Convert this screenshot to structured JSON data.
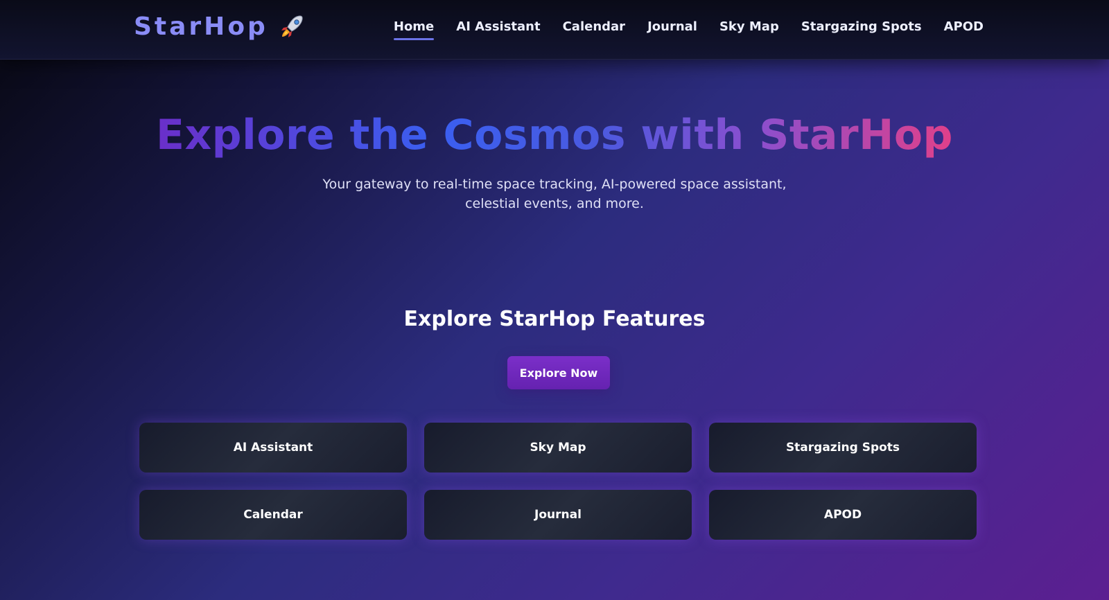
{
  "header": {
    "logo_text": "StarHop",
    "logo_icon": "rocket-icon",
    "nav": [
      {
        "label": "Home",
        "active": true
      },
      {
        "label": "AI Assistant"
      },
      {
        "label": "Calendar"
      },
      {
        "label": "Journal"
      },
      {
        "label": "Sky Map"
      },
      {
        "label": "Stargazing Spots"
      },
      {
        "label": "APOD"
      }
    ]
  },
  "hero": {
    "title": "Explore the Cosmos with StarHop",
    "subtitle": "Your gateway to real-time space tracking, AI-powered space assistant, celestial events, and more."
  },
  "features": {
    "title": "Explore StarHop Features",
    "cta_label": "Explore Now",
    "cards": [
      "AI Assistant",
      "Sky Map",
      "Stargazing Spots",
      "Calendar",
      "Journal",
      "APOD"
    ]
  },
  "colors": {
    "accent": "#6b72e6",
    "logo": "#8a8cf6",
    "button": "#7b2fc9",
    "card": "#1c2130"
  }
}
